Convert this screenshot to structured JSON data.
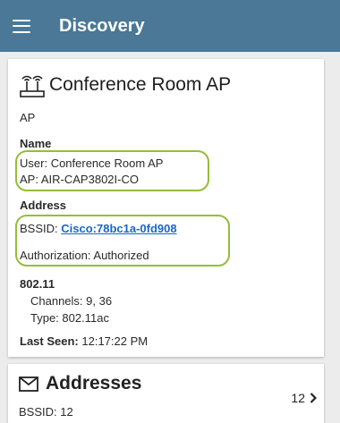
{
  "appbar": {
    "menu_icon": "hamburger-menu-icon",
    "title": "Discovery",
    "color": "#4a7896"
  },
  "device": {
    "icon": "access-point-icon",
    "title": "Conference Room AP",
    "type": "AP",
    "name_heading": "Name",
    "user_label": "User:",
    "user_value": "Conference Room AP",
    "ap_label": "AP:",
    "ap_value": "AIR-CAP3802I-CO",
    "address_heading": "Address",
    "bssid_label": "BSSID:",
    "bssid_value": "Cisco:78bc1a-0fd908",
    "authorization_label": "Authorization:",
    "authorization_value": "Authorized",
    "wifi_heading": "802.11",
    "channels_label": "Channels:",
    "channels_value": "9, 36",
    "type_label": "Type:",
    "type_value": "802.11ac",
    "last_seen_label": "Last Seen:",
    "last_seen_value": "12:17:22 PM"
  },
  "addresses": {
    "icon": "mail-icon",
    "title": "Addresses",
    "subtitle": "BSSID: 12",
    "count": "12",
    "chevron_icon": "chevron-right-icon"
  },
  "colors": {
    "highlight": "#95bd3a",
    "link": "#1a66c9"
  }
}
